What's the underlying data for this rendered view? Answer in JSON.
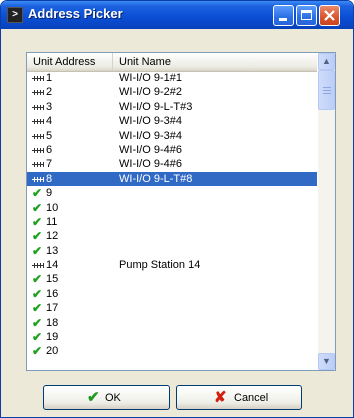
{
  "window": {
    "title": "Address Picker",
    "icon": "terminal-icon"
  },
  "list": {
    "columns": [
      "Unit Address",
      "Unit Name"
    ],
    "rows": [
      {
        "icon": "connector-icon",
        "address": "1",
        "name": "WI-I/O 9-1#1"
      },
      {
        "icon": "connector-icon",
        "address": "2",
        "name": "WI-I/O 9-2#2"
      },
      {
        "icon": "connector-icon",
        "address": "3",
        "name": "WI-I/O 9-L-T#3"
      },
      {
        "icon": "connector-icon",
        "address": "4",
        "name": "WI-I/O 9-3#4"
      },
      {
        "icon": "connector-icon",
        "address": "5",
        "name": "WI-I/O 9-3#4"
      },
      {
        "icon": "connector-icon",
        "address": "6",
        "name": "WI-I/O 9-4#6"
      },
      {
        "icon": "connector-icon",
        "address": "7",
        "name": "WI-I/O 9-4#6"
      },
      {
        "icon": "connector-icon",
        "address": "8",
        "name": "WI-I/O 9-L-T#8",
        "selected": true
      },
      {
        "icon": "check-icon",
        "address": "9",
        "name": ""
      },
      {
        "icon": "check-icon",
        "address": "10",
        "name": ""
      },
      {
        "icon": "check-icon",
        "address": "11",
        "name": ""
      },
      {
        "icon": "check-icon",
        "address": "12",
        "name": ""
      },
      {
        "icon": "check-icon",
        "address": "13",
        "name": ""
      },
      {
        "icon": "connector-icon",
        "address": "14",
        "name": "Pump Station 14"
      },
      {
        "icon": "check-icon",
        "address": "15",
        "name": ""
      },
      {
        "icon": "check-icon",
        "address": "16",
        "name": ""
      },
      {
        "icon": "check-icon",
        "address": "17",
        "name": ""
      },
      {
        "icon": "check-icon",
        "address": "18",
        "name": ""
      },
      {
        "icon": "check-icon",
        "address": "19",
        "name": ""
      },
      {
        "icon": "check-icon",
        "address": "20",
        "name": ""
      }
    ]
  },
  "buttons": {
    "ok": "OK",
    "cancel": "Cancel"
  },
  "colors": {
    "selection": "#316ac5",
    "check": "#20a020",
    "cancel_x": "#d02010",
    "titlebar": "#0a4fd6"
  }
}
